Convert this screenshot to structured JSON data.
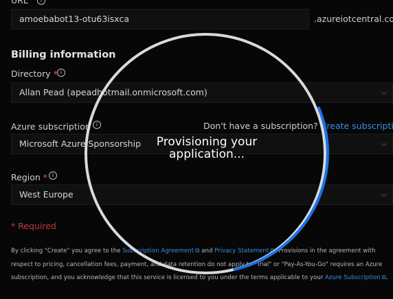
{
  "url": {
    "label": "URL",
    "value": "amoebabot13-otu63isxca",
    "suffix": ".azureiotcentral.com"
  },
  "billing": {
    "title": "Billing information",
    "directory": {
      "label": "Directory",
      "required_mark": "*",
      "value": "Allan Pead (apeadhotmail.onmicrosoft.com)"
    },
    "subscription": {
      "label": "Azure subscription",
      "prompt": "Don't have a subscription?",
      "create_link": "Create subscription",
      "value": "Microsoft Azure Sponsorship"
    },
    "region": {
      "label": "Region",
      "required_mark": "*",
      "value": "West Europe"
    },
    "required_note": "* Required"
  },
  "fine_print": {
    "part1": "By clicking \"Create\" you agree to the ",
    "subscription_agreement": "Subscription Agreement",
    "and": " and ",
    "privacy_statement": "Privacy Statement",
    "part2": ". Provisions in the agreement with respect to pricing, cancellation fees, payment, and data retention do not apply to \"Trial\" or \"Pay-As-You-Go\" requires an Azure subscription, and you acknowledge that this service is licensed to you under the terms applicable to your ",
    "azure_subscription": "Azure Subscription",
    "end": "."
  },
  "overlay": {
    "line1": "Provisioning your",
    "line2": "application...",
    "track_color": "#d9d9d9",
    "progress_color": "#1a73e8"
  },
  "colors": {
    "background": "#070707",
    "link": "#3a8ee6",
    "required": "#e05252"
  }
}
